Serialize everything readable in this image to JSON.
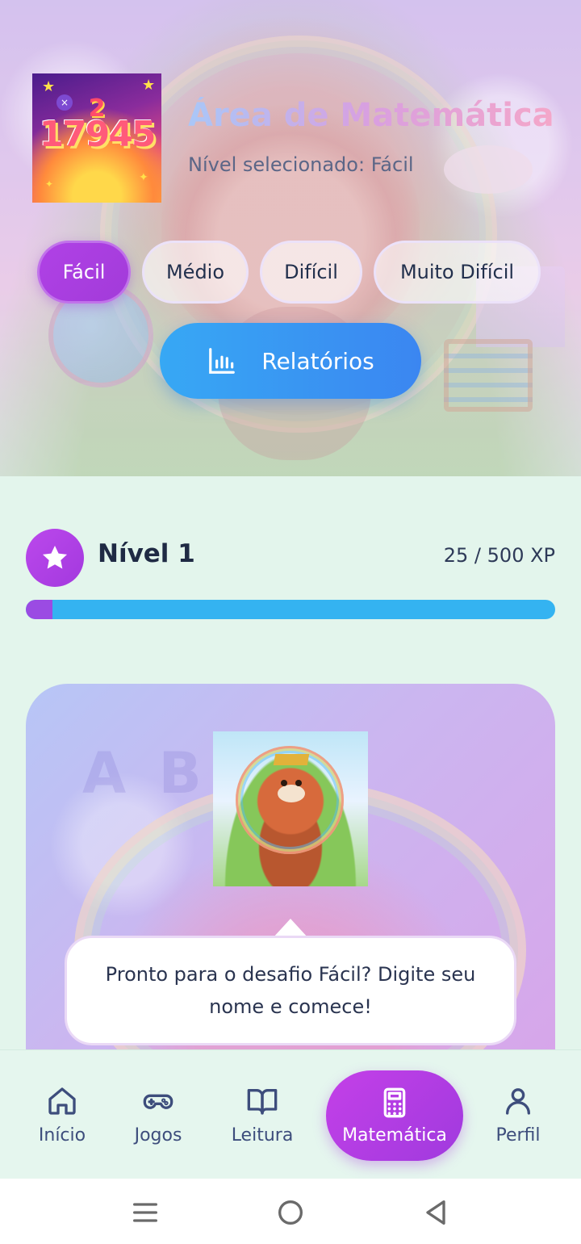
{
  "header": {
    "title": "Área de Matemática",
    "subtitle": "Nível selecionado: Fácil",
    "app_icon": {
      "digit_top": "2",
      "number": "17945"
    }
  },
  "level_tabs": [
    {
      "label": "Fácil",
      "active": true
    },
    {
      "label": "Médio",
      "active": false
    },
    {
      "label": "Difícil",
      "active": false
    },
    {
      "label": "Muito Difícil",
      "active": false
    }
  ],
  "reports_button": {
    "label": "Relatórios",
    "icon": "bar-chart-icon"
  },
  "progress": {
    "level_label": "Nível 1",
    "xp_text": "25 / 500 XP",
    "xp_current": 25,
    "xp_max": 500,
    "fill_fraction": 0.05,
    "badge_icon": "star-icon"
  },
  "challenge": {
    "message": "Pronto para o desafio Fácil? Digite seu nome e comece!"
  },
  "bottom_nav": [
    {
      "label": "Início",
      "icon": "home-icon",
      "active": false
    },
    {
      "label": "Jogos",
      "icon": "gamepad-icon",
      "active": false
    },
    {
      "label": "Leitura",
      "icon": "book-open-icon",
      "active": false
    },
    {
      "label": "Matemática",
      "icon": "calculator-icon",
      "active": true
    },
    {
      "label": "Perfil",
      "icon": "user-icon",
      "active": false
    }
  ],
  "system_nav": [
    "menu-icon",
    "home-circle-icon",
    "back-triangle-icon"
  ],
  "colors": {
    "accent_purple": "#a83ce0",
    "accent_blue": "#3b96f2",
    "background": "#e3f5ec",
    "text_dark": "#1f2a44"
  }
}
